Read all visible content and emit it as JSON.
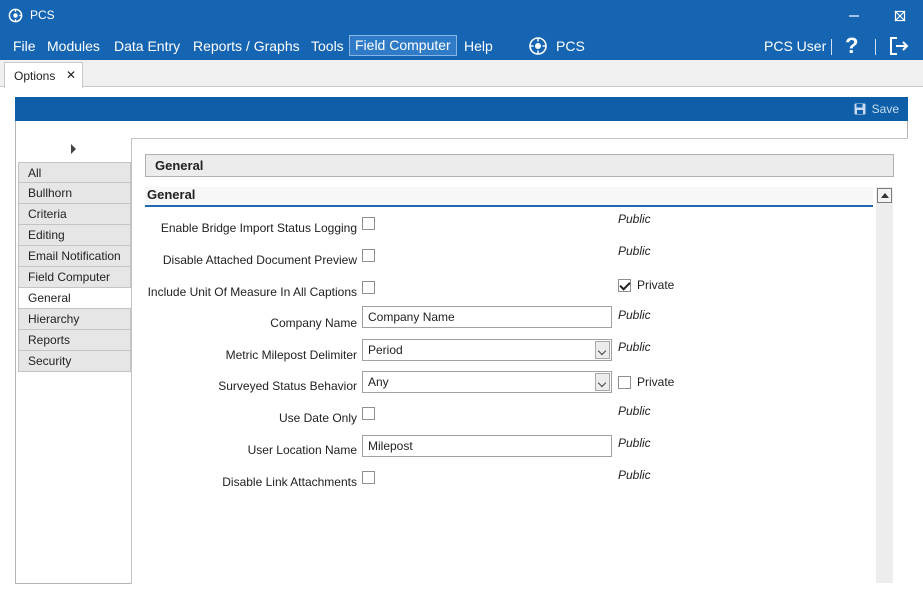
{
  "window": {
    "title": "PCS",
    "icon": "pcs-logo-icon",
    "controls": [
      "minimize-icon",
      "maximize-icon",
      "close-icon"
    ]
  },
  "menu": {
    "items": [
      "File",
      "Modules",
      "Data Entry",
      "Reports / Graphs",
      "Tools",
      "Field Computer",
      "Help"
    ],
    "active": "Field Computer",
    "brand": "PCS",
    "user": "PCS User",
    "help_glyph": "?"
  },
  "doc_tab": {
    "label": "Options",
    "close": "✕"
  },
  "toolbar": {
    "save_label": "Save"
  },
  "sidenav": {
    "items": [
      "All",
      "Bullhorn",
      "Criteria",
      "Editing",
      "Email Notification",
      "Field Computer",
      "General",
      "Hierarchy",
      "Reports",
      "Security"
    ],
    "selected": "General"
  },
  "section_title": "General",
  "group_title": "General",
  "settings": [
    {
      "label": "Enable Bridge Import Status Logging",
      "type": "checkbox",
      "checked": false,
      "visibility": "Public"
    },
    {
      "label": "Disable Attached Document Preview",
      "type": "checkbox",
      "checked": false,
      "visibility": "Public"
    },
    {
      "label": "Include Unit Of Measure In All Captions",
      "type": "checkbox",
      "checked": false,
      "visibility": "Private",
      "visibility_checked": true
    },
    {
      "label": "Company Name",
      "type": "text",
      "value": "Company Name",
      "visibility": "Public"
    },
    {
      "label": "Metric Milepost Delimiter",
      "type": "select",
      "value": "Period",
      "visibility": "Public"
    },
    {
      "label": "Surveyed Status Behavior",
      "type": "select",
      "value": "Any",
      "visibility": "Private",
      "visibility_checked": false
    },
    {
      "label": "Use Date Only",
      "type": "checkbox",
      "checked": false,
      "visibility": "Public"
    },
    {
      "label": "User Location Name",
      "type": "text",
      "value": "Milepost",
      "visibility": "Public"
    },
    {
      "label": "Disable Link Attachments",
      "type": "checkbox",
      "checked": false,
      "visibility": "Public"
    }
  ]
}
